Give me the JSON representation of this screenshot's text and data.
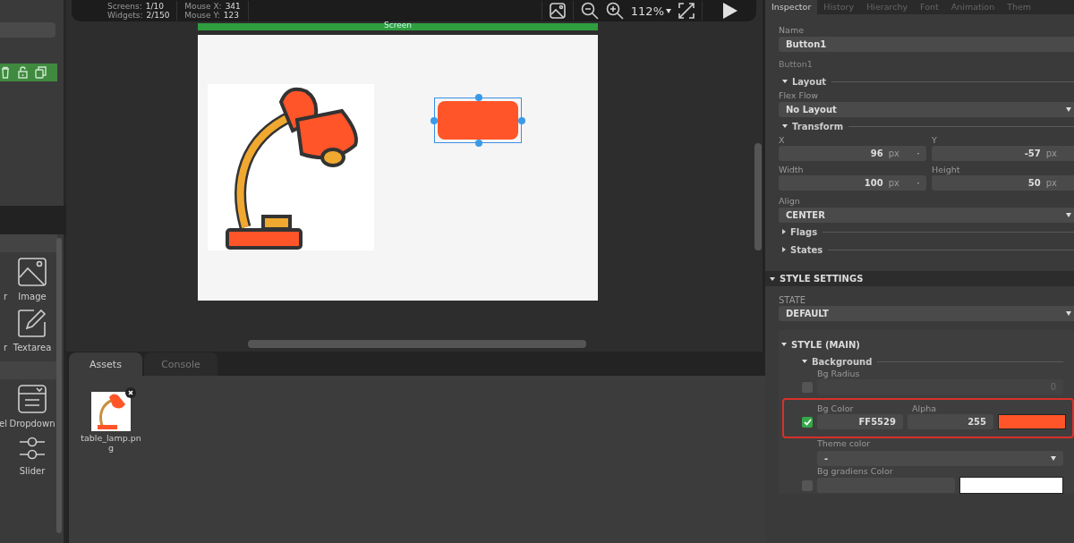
{
  "toolbar": {
    "stats": [
      {
        "label": "Screens:",
        "value": "1/10"
      },
      {
        "label": "Widgets:",
        "value": "2/150"
      }
    ],
    "mouse": [
      {
        "label": "Mouse X:",
        "value": "341"
      },
      {
        "label": "Mouse Y:",
        "value": "123"
      }
    ],
    "zoom": "112%"
  },
  "left_panel": {
    "sections": [
      {
        "widgets": [
          {
            "label": "r",
            "kind": "cut"
          },
          {
            "label": "Image",
            "kind": "image"
          },
          {
            "label": "r",
            "kind": "cut"
          },
          {
            "label": "Textarea",
            "kind": "textarea"
          }
        ]
      },
      {
        "widgets": [
          {
            "label": "el",
            "kind": "cut"
          },
          {
            "label": "Dropdown",
            "kind": "dropdown"
          },
          {
            "kind": "empty"
          },
          {
            "label": "Slider",
            "kind": "slider"
          }
        ]
      }
    ]
  },
  "canvas": {
    "screen_title": "Screen",
    "widgets": [
      {
        "kind": "image"
      },
      {
        "kind": "button",
        "selected": true
      }
    ]
  },
  "bottom_panel": {
    "tabs": [
      {
        "label": "Assets",
        "selected": true
      },
      {
        "label": "Console",
        "selected": false
      }
    ],
    "assets": [
      {
        "name": "table_lamp.png"
      }
    ]
  },
  "inspector": {
    "tabs": [
      {
        "label": "Inspector",
        "selected": true
      },
      {
        "label": "History",
        "selected": false
      },
      {
        "label": "Hierarchy",
        "selected": false
      },
      {
        "label": "Font",
        "selected": false
      },
      {
        "label": "Animation",
        "selected": false
      },
      {
        "label": "Them",
        "selected": false
      }
    ],
    "name": {
      "label": "Name",
      "value": "Button1"
    },
    "type": "Button1",
    "layout": {
      "title": "Layout",
      "expanded": true,
      "flex_flow": {
        "label": "Flex Flow",
        "value": "No Layout"
      }
    },
    "transform": {
      "title": "Transform",
      "expanded": true,
      "fields": [
        {
          "label": "X",
          "value": "96",
          "unit": "px"
        },
        {
          "label": "Y",
          "value": "-57",
          "unit": "px"
        },
        {
          "label": "Width",
          "value": "100",
          "unit": "px"
        },
        {
          "label": "Height",
          "value": "50",
          "unit": "px"
        }
      ],
      "align": {
        "label": "Align",
        "value": "CENTER"
      }
    },
    "collapsed_sections": [
      {
        "title": "Flags",
        "expanded": false
      },
      {
        "title": "States",
        "expanded": false
      }
    ],
    "style_settings": {
      "title": "STYLE SETTINGS",
      "expanded": true,
      "state": {
        "label": "STATE",
        "value": "DEFAULT"
      },
      "style_main": {
        "title": "STYLE (MAIN)",
        "expanded": true
      },
      "background": {
        "title": "Background",
        "expanded": true
      },
      "bg_radius": {
        "label": "Bg Radius",
        "checked": false,
        "value": "0"
      },
      "bg_color": {
        "label": "Bg Color",
        "value": "FF5529",
        "alpha_label": "Alpha",
        "alpha": "255",
        "checked": true,
        "highlighted": true
      },
      "theme_color": {
        "label": "Theme color",
        "value": "-"
      },
      "gradient": {
        "label": "Bg gradiens Color",
        "checked": false
      }
    }
  }
}
